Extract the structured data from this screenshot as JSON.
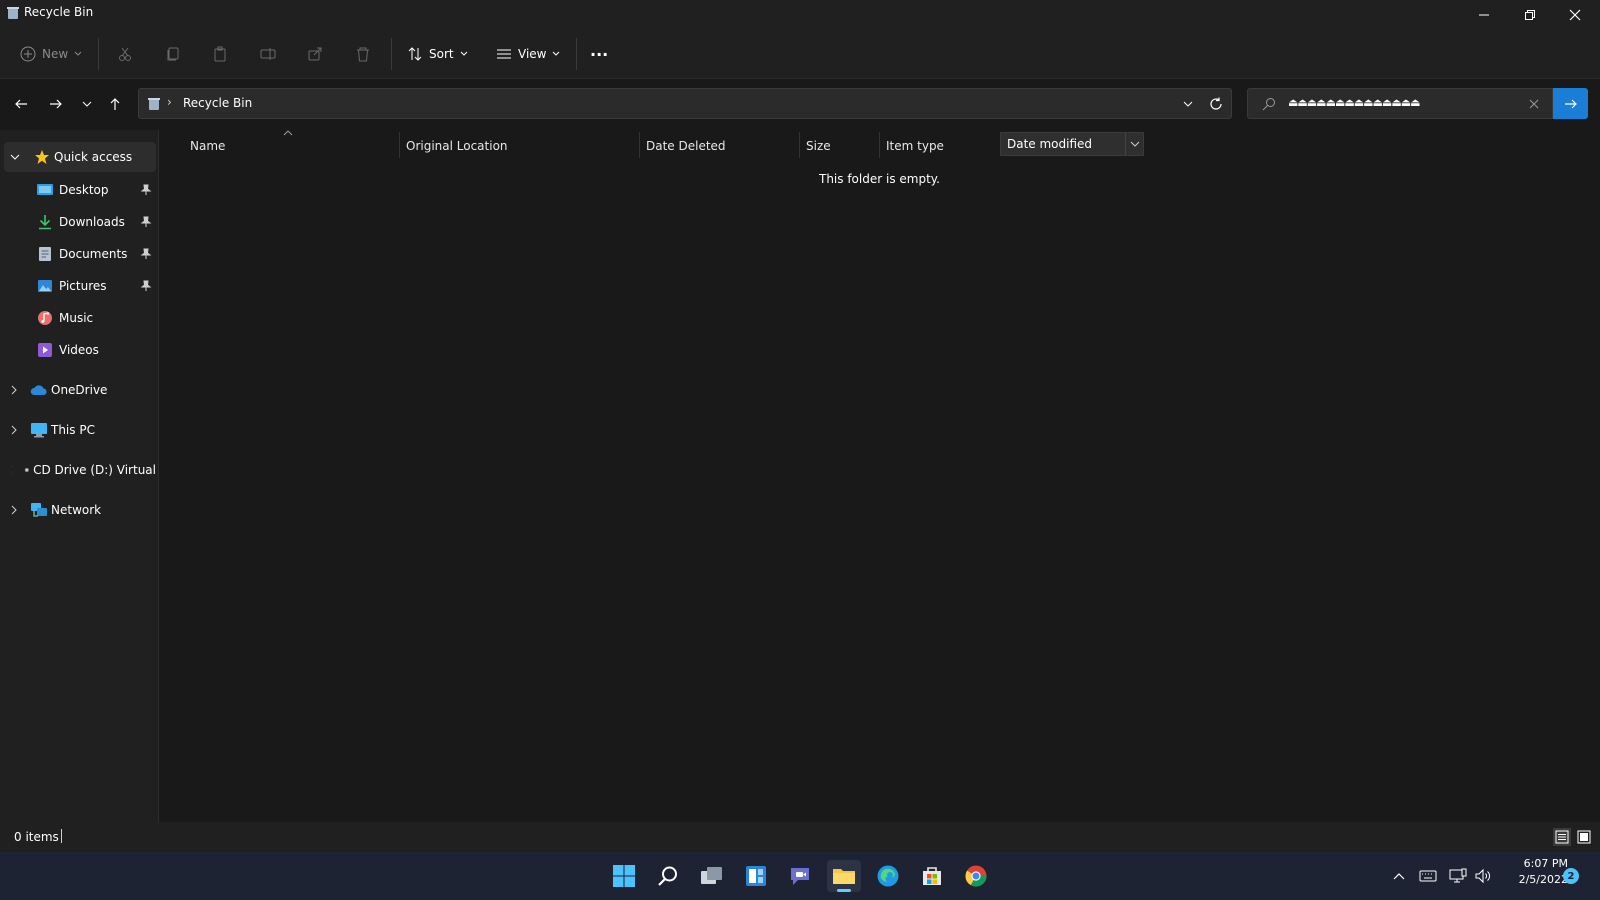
{
  "window": {
    "title": "Recycle Bin"
  },
  "toolbar": {
    "new_label": "New",
    "sort_label": "Sort",
    "view_label": "View",
    "more_label": "···"
  },
  "address": {
    "breadcrumb_sep": "›",
    "location": "Recycle Bin"
  },
  "search": {
    "query": "⏏⏏⏏⏏⏏⏏⏏⏏⏏⏏⏏⏏⏏⏏"
  },
  "sidebar": {
    "quick_access": "Quick access",
    "items": [
      {
        "label": "Desktop",
        "icon": "desktop-icon",
        "pinned": true
      },
      {
        "label": "Downloads",
        "icon": "downloads-icon",
        "pinned": true
      },
      {
        "label": "Documents",
        "icon": "documents-icon",
        "pinned": true
      },
      {
        "label": "Pictures",
        "icon": "pictures-icon",
        "pinned": true
      },
      {
        "label": "Music",
        "icon": "music-icon",
        "pinned": false
      },
      {
        "label": "Videos",
        "icon": "videos-icon",
        "pinned": false
      }
    ],
    "roots": [
      {
        "label": "OneDrive",
        "icon": "onedrive-icon"
      },
      {
        "label": "This PC",
        "icon": "this-pc-icon"
      },
      {
        "label": "CD Drive (D:) Virtual",
        "icon": "cd-drive-icon"
      },
      {
        "label": "Network",
        "icon": "network-icon"
      }
    ]
  },
  "columns": {
    "name": "Name",
    "original_location": "Original Location",
    "date_deleted": "Date Deleted",
    "size": "Size",
    "item_type": "Item type",
    "date_modified": "Date modified"
  },
  "content": {
    "empty_message": "This folder is empty."
  },
  "status": {
    "item_count": "0 items"
  },
  "tray": {
    "time": "6:07 PM",
    "date": "2/5/2022",
    "notification_count": "2"
  },
  "colors": {
    "accent": "#1a7ed6",
    "background": "#191919",
    "chrome": "#202020",
    "taskbar": "#1d2333"
  }
}
